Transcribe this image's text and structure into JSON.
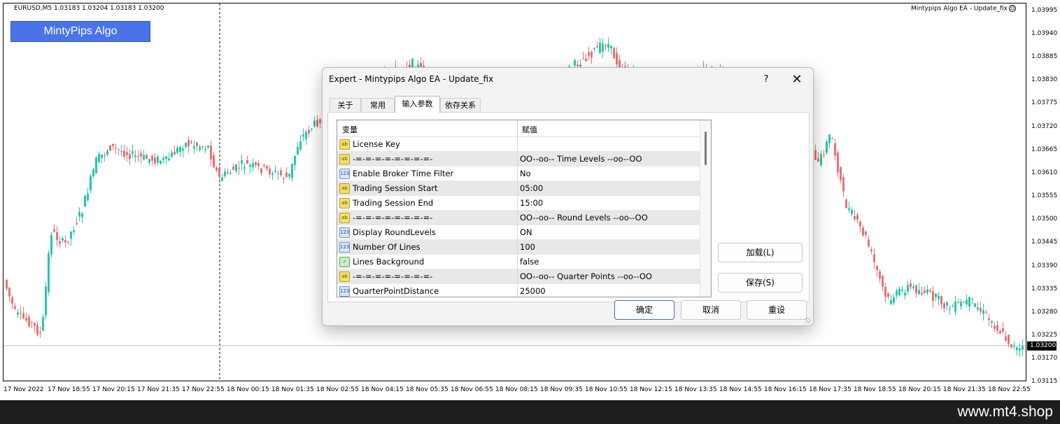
{
  "chart": {
    "symbol_info": "EURUSD,M5  1.03183 1.03204 1.03183 1.03200",
    "ea_info": "Mintypips Algo EA - Update_fix",
    "smiley": "☺",
    "brand_button": "MintyPips Algo",
    "price_axis": [
      "1.03995",
      "1.03940",
      "1.03885",
      "1.03830",
      "1.03775",
      "1.03720",
      "1.03665",
      "1.03610",
      "1.03555",
      "1.03500",
      "1.03445",
      "1.03390",
      "1.03335",
      "1.03280",
      "1.03225",
      "1.03170",
      "1.03115"
    ],
    "current_price": "1.03200",
    "time_axis": [
      "17 Nov 2022",
      "17 Nov 18:55",
      "17 Nov 20:15",
      "17 Nov 21:35",
      "17 Nov 22:55",
      "18 Nov 00:15",
      "18 Nov 01:35",
      "18 Nov 02:55",
      "18 Nov 04:15",
      "18 Nov 05:35",
      "18 Nov 06:55",
      "18 Nov 08:15",
      "18 Nov 09:35",
      "18 Nov 10:55",
      "18 Nov 12:15",
      "18 Nov 13:35",
      "18 Nov 14:55",
      "18 Nov 16:15",
      "18 Nov 17:35",
      "18 Nov 18:55",
      "18 Nov 20:15",
      "18 Nov 21:35",
      "18 Nov 22:55"
    ],
    "colors": {
      "bull": "#26c6b0",
      "bear": "#e57373",
      "brand": "#4a73e8"
    }
  },
  "dialog": {
    "title": "Expert - Mintypips Algo EA - Update_fix",
    "help": "?",
    "close": "✕",
    "tabs": [
      "关于",
      "常用",
      "输入参数",
      "依存关系"
    ],
    "active_tab": "输入参数",
    "columns": {
      "variable": "变量",
      "value": "赋值"
    },
    "params": [
      {
        "type": "ab",
        "name": "License Key",
        "value": ""
      },
      {
        "type": "ab",
        "name": "-=-=-=-=-=-=-=-=-",
        "value": " OO--oo-- Time Levels --oo--OO"
      },
      {
        "type": "123",
        "name": "Enable Broker Time Filter",
        "value": "No"
      },
      {
        "type": "ab",
        "name": "Trading Session Start",
        "value": "05:00"
      },
      {
        "type": "ab",
        "name": "Trading Session End",
        "value": "15:00"
      },
      {
        "type": "ab",
        "name": "-=-=-=-=-=-=-=-=-",
        "value": " OO--oo-- Round Levels --oo--OO"
      },
      {
        "type": "123",
        "name": "Display RoundLevels",
        "value": "ON"
      },
      {
        "type": "123",
        "name": "Number Of Lines",
        "value": "100"
      },
      {
        "type": "bool",
        "name": "Lines Background",
        "value": "false"
      },
      {
        "type": "ab",
        "name": "-=-=-=-=-=-=-=-=-",
        "value": " OO--oo-- Quarter Points --oo--OO"
      },
      {
        "type": "123",
        "name": "QuarterPointDistance",
        "value": "25000"
      }
    ],
    "buttons": {
      "load": "加载(L)",
      "save": "保存(S)",
      "ok": "确定",
      "cancel": "取消",
      "reset": "重设"
    }
  },
  "footer": {
    "site": "www.mt4.shop"
  }
}
